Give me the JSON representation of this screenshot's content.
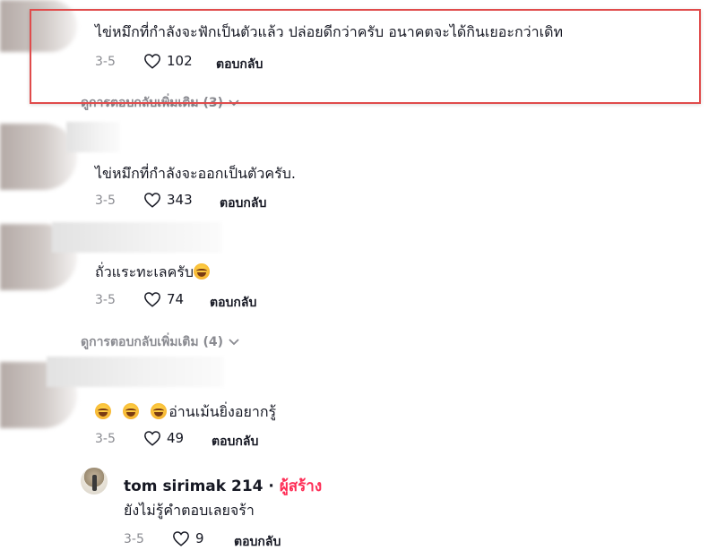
{
  "comments": [
    {
      "text": "ไข่หมึกที่กำลังจะฟักเป็นตัวแล้ว ปล่อยดีกว่าครับ อนาคตจะได้กินเยอะกว่าเดิท",
      "date": "3-5",
      "likes": "102",
      "reply_label": "ตอบกลับ",
      "more_replies": "ดูการตอบกลับเพิ่มเติม (3)"
    },
    {
      "text": "ไข่หมึกที่กำลังจะออกเป็นตัวครับ.",
      "date": "3-5",
      "likes": "343",
      "reply_label": "ตอบกลับ"
    },
    {
      "text": "ถั่วแระทะเลครับ",
      "date": "3-5",
      "likes": "74",
      "reply_label": "ตอบกลับ",
      "more_replies": "ดูการตอบกลับเพิ่มเติม (4)"
    },
    {
      "text": "อ่านเม้นยิ่งอยากรู้",
      "date": "3-5",
      "likes": "49",
      "reply_label": "ตอบกลับ"
    }
  ],
  "reply": {
    "author": "tom sirimak 214",
    "separator": "·",
    "creator_tag": "ผู้สร้าง",
    "text": "ยังไม่รู้คำตอบเลยจร้า",
    "date": "3-5",
    "likes": "9",
    "reply_label": "ตอบกลับ"
  },
  "icons": {
    "like": "heart-outline-icon",
    "expand": "chevron-down-icon",
    "emoji": "laughing-tears-emoji"
  },
  "colors": {
    "highlight": "#e04b4b",
    "creator": "#fe2c55",
    "muted": "#8a8b91"
  }
}
